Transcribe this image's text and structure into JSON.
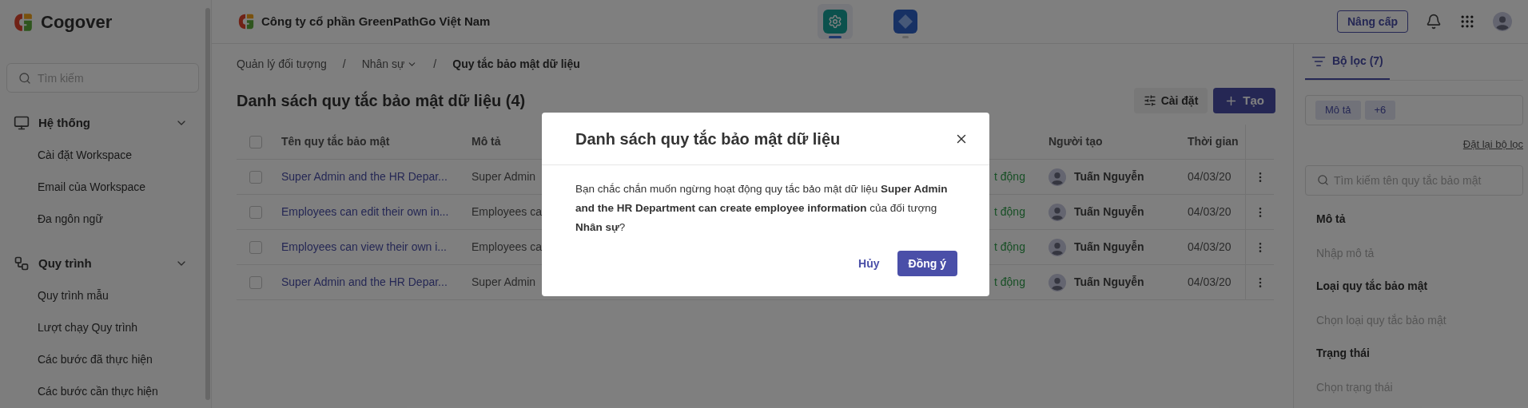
{
  "sidebar": {
    "brand": "Cogover",
    "search": {
      "placeholder": "Tìm kiếm"
    },
    "sections": [
      {
        "kind": "system",
        "title": "Hệ thống",
        "expanded": true,
        "items": [
          "Cài đặt Workspace",
          "Email của Workspace",
          "Đa ngôn ngữ"
        ]
      },
      {
        "kind": "workflow",
        "title": "Quy trình",
        "expanded": true,
        "items": [
          "Quy trình mẫu",
          "Lượt chạy Quy trình",
          "Các bước đã thực hiện",
          "Các bước cần thực hiện"
        ]
      }
    ]
  },
  "header": {
    "company": "Công ty cổ phần GreenPathGo Việt Nam",
    "apps": [
      {
        "kind": "settings",
        "selected": true
      },
      {
        "kind": "diamond",
        "selected": false
      }
    ],
    "upgrade_button": "Nâng cấp"
  },
  "breadcrumb": {
    "separator": "/",
    "items": [
      {
        "label": "Quản lý đối tượng",
        "dropdown": false,
        "current": false
      },
      {
        "label": "Nhân sự",
        "dropdown": true,
        "current": false
      },
      {
        "label": "Quy tắc bảo mật dữ liệu",
        "dropdown": false,
        "current": true
      }
    ]
  },
  "page_title": "Danh sách quy tắc bảo mật dữ liệu (4)",
  "actions": {
    "settings": "Cài đặt",
    "create": "Tạo"
  },
  "table": {
    "all_checked": false,
    "columns": [
      "Tên quy tắc bảo mật",
      "Mô tả",
      "Người tạo",
      "Thời gian"
    ],
    "rows": [
      {
        "checked": false,
        "name": "Super Admin and the HR Depar...",
        "description": "Super Admin",
        "status": "t động",
        "creator": "Tuấn Nguyễn",
        "time": "04/03/20"
      },
      {
        "checked": false,
        "name": "Employees can edit their own in...",
        "description": "Employees ca",
        "status": "t động",
        "creator": "Tuấn Nguyễn",
        "time": "04/03/20"
      },
      {
        "checked": false,
        "name": "Employees can view their own i...",
        "description": "Employees ca",
        "status": "t động",
        "creator": "Tuấn Nguyễn",
        "time": "04/03/20"
      },
      {
        "checked": false,
        "name": "Super Admin and the HR Depar...",
        "description": "Super Admin",
        "status": "t động",
        "creator": "Tuấn Nguyễn",
        "time": "04/03/20"
      }
    ]
  },
  "filter": {
    "tab": {
      "label": "Bộ lọc (7)",
      "selected": true
    },
    "chips": [
      "Mô tả",
      "+6"
    ],
    "reset": "Đặt lại bộ lọc",
    "search": {
      "placeholder": "Tìm kiếm tên quy tắc bảo mật"
    },
    "fields": [
      {
        "label": "Mô tả",
        "placeholder": "Nhập mô tả"
      },
      {
        "label": "Loại quy tắc bảo mật",
        "placeholder": "Chọn loại quy tắc bảo mật"
      },
      {
        "label": "Trạng thái",
        "placeholder": "Chọn trạng thái"
      }
    ]
  },
  "dialog": {
    "title": "Danh sách quy tắc bảo mật dữ liệu",
    "message": "Bạn chắc chắn muốn ngừng hoạt động quy tắc bảo mật dữ liệu **Super Admin and the HR Department can create employee information** của đối tượng **Nhân sự**?",
    "cancel": "Hủy",
    "confirm": "Đồng ý"
  }
}
